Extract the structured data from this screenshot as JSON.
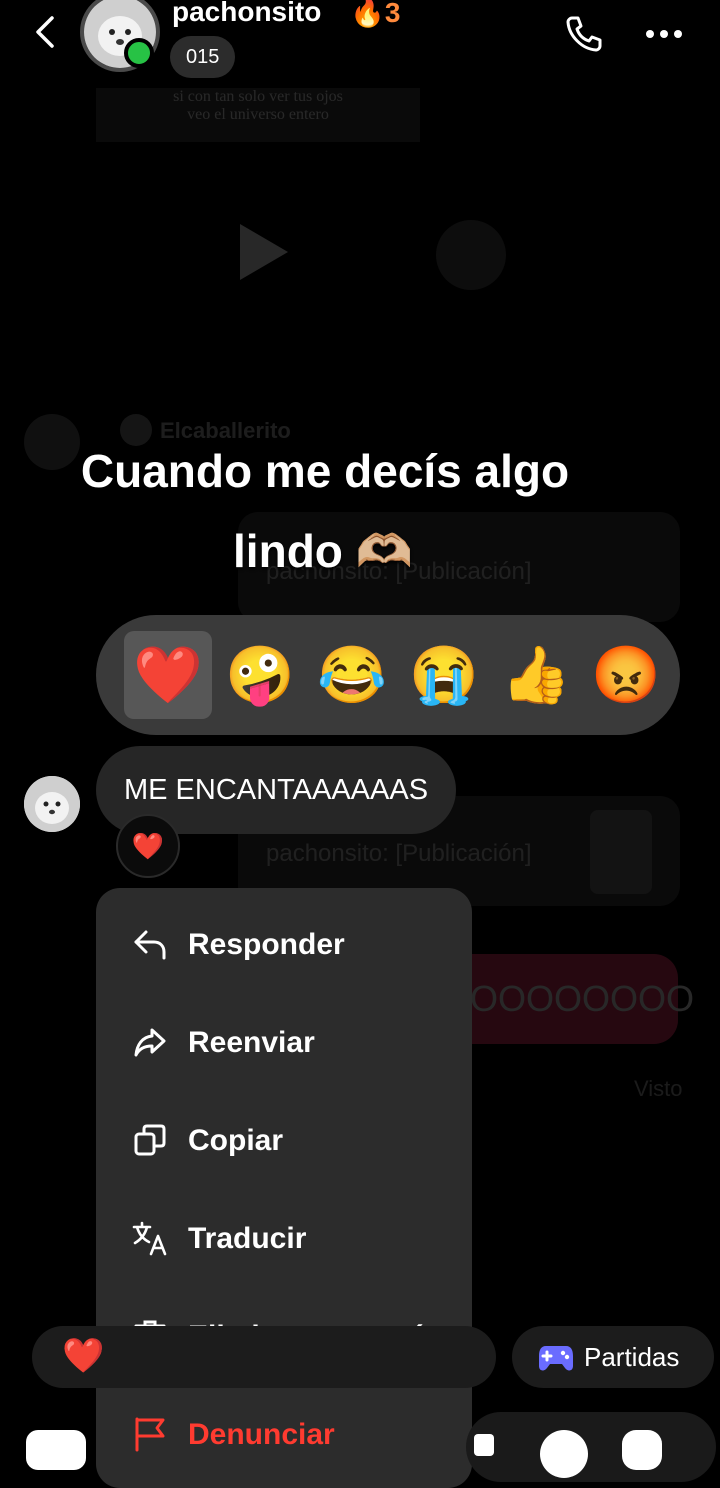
{
  "header": {
    "username": "pachonsito",
    "streak": "🔥3",
    "subtitle": "015"
  },
  "background_chat": {
    "story_lines": [
      "si con tan solo ver tus ojos",
      "veo el universo entero"
    ],
    "sender_name": "Elcaballerito",
    "publication_1": "pachonsito: [Publicación]",
    "publication_2": "pachonsito: [Publicación]",
    "long_message": "OOOOOOOO",
    "seen_label": "Visto"
  },
  "caption": {
    "line1": "Cuando me decís algo",
    "line2": "lindo 🫶🏼"
  },
  "reactions": [
    "❤️",
    "🤪",
    "😂",
    "😭",
    "👍",
    "😡"
  ],
  "message": {
    "text": "ME ENCANTAAAAAAS",
    "reaction": "❤️"
  },
  "menu": {
    "items": [
      {
        "label": "Responder",
        "icon": "reply-icon"
      },
      {
        "label": "Reenviar",
        "icon": "forward-icon"
      },
      {
        "label": "Copiar",
        "icon": "copy-icon"
      },
      {
        "label": "Traducir",
        "icon": "translate-icon"
      },
      {
        "label": "Eliminar para mí",
        "icon": "trash-icon"
      },
      {
        "label": "Denunciar",
        "icon": "flag-icon"
      }
    ]
  },
  "bottom": {
    "quick_reaction": "❤️",
    "partidas_label": "Partidas"
  },
  "colors": {
    "accent_green": "#27c245",
    "danger": "#ff3b30",
    "streak": "#ff8a3d",
    "menu_bg": "#2c2c2c"
  }
}
